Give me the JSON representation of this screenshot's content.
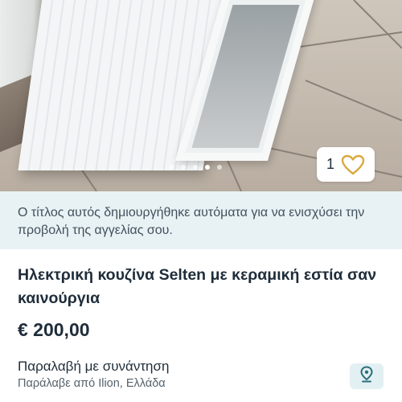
{
  "gallery": {
    "image_description_icon": "photo-of-electric-stove",
    "like_count": "1",
    "like_icon": "heart-icon",
    "dots_total": 5,
    "dots_active_index": 3
  },
  "notice": {
    "text": "Ο τίτλος αυτός δημιουργήθηκε αυτόματα για να ενισχύσει την προβολή της αγγελίας σου."
  },
  "listing": {
    "title": "Ηλεκτρική κουζίνα Selten με κεραμική εστία σαν καινούργια",
    "price": "€ 200,00"
  },
  "delivery": {
    "method": "Παραλαβή με συνάντηση",
    "location": "Παράλαβε από Ilion, Ελλάδα",
    "map_icon": "map-pin-icon"
  },
  "colors": {
    "accent": "#2d6f7c",
    "heart": "#d9a93f",
    "notice_bg": "#e8f2f5"
  }
}
